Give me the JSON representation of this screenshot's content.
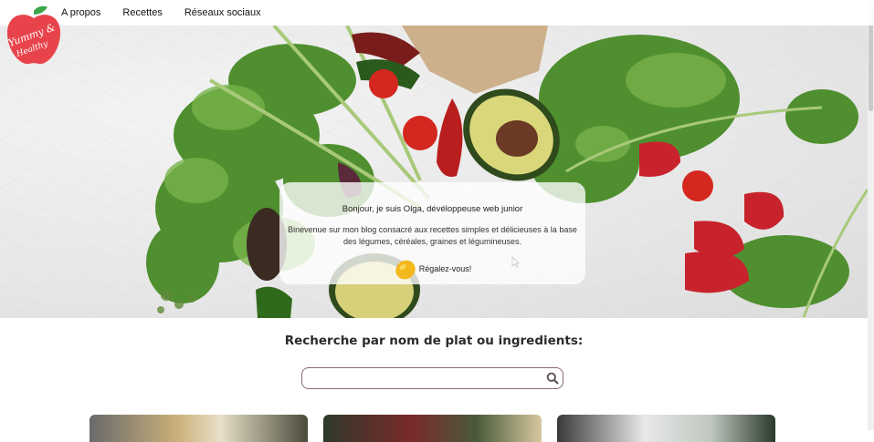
{
  "nav": {
    "items": [
      {
        "label": "A propos"
      },
      {
        "label": "Recettes"
      },
      {
        "label": "Réseaux sociaux"
      }
    ]
  },
  "logo": {
    "text_line1": "Yummy &",
    "text_line2": "Healthy"
  },
  "intro": {
    "title": "Bonjour, je suis Olga, dévéloppeuse web junior",
    "text": "Binevenue sur mon blog consacré aux recettes simples et délicieuses à la base des légumes, céréales, graines et légumineuses.",
    "cta": "Régalez-vous!"
  },
  "search": {
    "title": "Recherche par nom de plat ou ingredients:",
    "placeholder": ""
  },
  "colors": {
    "logo_red": "#e8434a",
    "leaf_green": "#3aa64a",
    "search_border": "#8a6a6a"
  }
}
